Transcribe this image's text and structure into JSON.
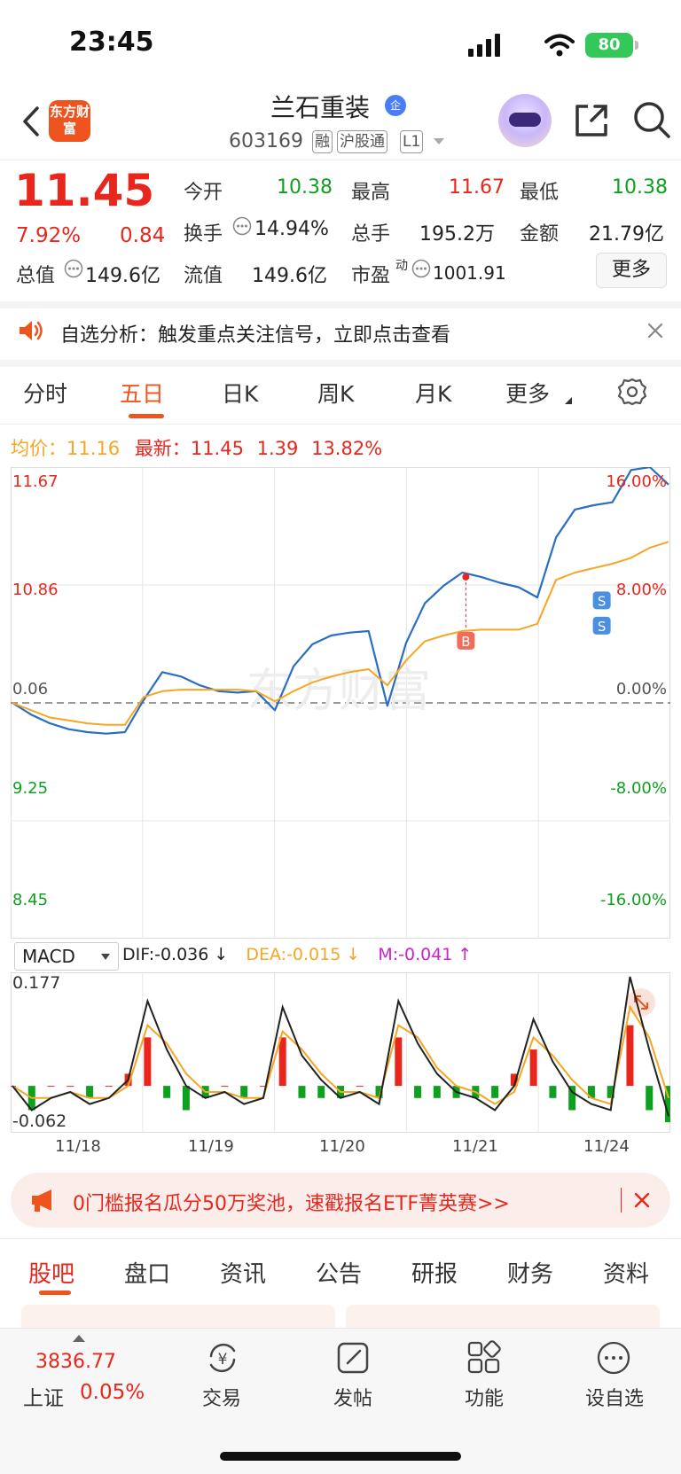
{
  "status_bar": {
    "time": "23:45",
    "battery": "80"
  },
  "header": {
    "logo_text": "东方财富",
    "stock_name": "兰石重装",
    "badge": "企",
    "stock_code": "603169",
    "tags": [
      "融",
      "沪股通",
      "L1"
    ]
  },
  "quote": {
    "price": "11.45",
    "change_pct": "7.92%",
    "change": "0.84",
    "open_label": "今开",
    "open": "10.38",
    "high_label": "最高",
    "high": "11.67",
    "low_label": "最低",
    "low": "10.38",
    "turnover_label": "换手",
    "turnover": "14.94%",
    "volume_label": "总手",
    "volume": "195.2万",
    "amount_label": "金额",
    "amount": "21.79亿",
    "mktcap_label": "总值",
    "mktcap": "149.6亿",
    "float_label": "流值",
    "float": "149.6亿",
    "pe_label": "市盈",
    "pe_sup": "动",
    "pe": "1001.91",
    "more_label": "更多"
  },
  "notice": {
    "text": "自选分析：触发重点关注信号，立即点击查看"
  },
  "chart_tabs": [
    "分时",
    "五日",
    "日K",
    "周K",
    "月K",
    "更多"
  ],
  "chart_tabs_active": "五日",
  "avg_line": {
    "avg_label": "均价：",
    "avg": "11.16",
    "latest_label": "最新：",
    "latest": "11.45",
    "change": "1.39",
    "pct": "13.82%"
  },
  "chart_data": {
    "type": "line",
    "x": [
      "11/18",
      "11/19",
      "11/20",
      "11/21",
      "11/24"
    ],
    "y_left_ticks": [
      "11.67",
      "10.86",
      "0.06",
      "9.25",
      "8.45"
    ],
    "y_right_ticks": [
      "16.00%",
      "8.00%",
      "0.00%",
      "-8.00%",
      "-16.00%"
    ],
    "ylim": [
      8.45,
      11.67
    ],
    "prev_close": 10.06,
    "series": [
      {
        "color": "#2a6fbf",
        "values": [
          10.06,
          9.98,
          9.92,
          9.88,
          9.86,
          9.85,
          9.86,
          10.08,
          10.27,
          10.24,
          10.18,
          10.14,
          10.13,
          10.14,
          10.01,
          10.31,
          10.46,
          10.52,
          10.54,
          10.55,
          10.04,
          10.47,
          10.74,
          10.86,
          10.95,
          10.92,
          10.88,
          10.85,
          10.78,
          11.19,
          11.38,
          11.41,
          11.43,
          11.65,
          11.67,
          11.55
        ]
      },
      {
        "color": "#f5a623",
        "values": [
          10.06,
          10.01,
          9.96,
          9.94,
          9.92,
          9.91,
          9.91,
          10.1,
          10.14,
          10.15,
          10.15,
          10.15,
          10.15,
          10.14,
          10.07,
          10.14,
          10.2,
          10.24,
          10.27,
          10.29,
          10.18,
          10.35,
          10.48,
          10.52,
          10.55,
          10.56,
          10.56,
          10.56,
          10.6,
          10.9,
          10.95,
          10.98,
          11.01,
          11.05,
          11.12,
          11.16
        ]
      }
    ],
    "markers": [
      {
        "label": "B",
        "x_index": 3,
        "price": 10.92,
        "color": "#e8261c"
      },
      {
        "label": "S",
        "x_index": 4,
        "price": 10.76,
        "color": "#2a6fbf"
      },
      {
        "label": "S",
        "x_index": 4,
        "price": 10.66,
        "color": "#2a6fbf"
      }
    ],
    "watermark": "东方财富"
  },
  "macd": {
    "selector": "MACD",
    "dif": "DIF:-0.036 ↓",
    "dea": "DEA:-0.015 ↓",
    "m": "M:-0.041 ↑",
    "top": "0.177",
    "bottom": "-0.062",
    "dif_series": [
      0,
      -0.04,
      -0.02,
      -0.01,
      -0.03,
      -0.02,
      0.01,
      0.14,
      0.06,
      0.0,
      -0.02,
      -0.01,
      -0.03,
      -0.02,
      0.13,
      0.05,
      0.01,
      -0.02,
      -0.01,
      -0.03,
      0.14,
      0.07,
      0.02,
      -0.01,
      -0.02,
      -0.04,
      0.0,
      0.11,
      0.04,
      -0.01,
      -0.03,
      -0.04,
      0.18,
      0.06,
      -0.05
    ],
    "dea_series": [
      0,
      -0.02,
      -0.02,
      -0.01,
      -0.02,
      -0.02,
      0.0,
      0.1,
      0.07,
      0.02,
      -0.01,
      -0.01,
      -0.02,
      -0.02,
      0.09,
      0.06,
      0.02,
      -0.01,
      -0.01,
      -0.02,
      0.1,
      0.08,
      0.03,
      0.0,
      -0.01,
      -0.03,
      -0.01,
      0.08,
      0.05,
      0.01,
      -0.02,
      -0.03,
      0.13,
      0.08,
      -0.02
    ]
  },
  "promo": {
    "text": "0门槛报名瓜分50万奖池，速戳报名ETF菁英赛>>"
  },
  "bottom_tabs": [
    "股吧",
    "盘口",
    "资讯",
    "公告",
    "研报",
    "财务",
    "资料"
  ],
  "footer": {
    "index_value": "3836.77",
    "index_name": "上证",
    "index_pct": "0.05%",
    "trade": "交易",
    "post": "发帖",
    "features": "功能",
    "watchlist": "设自选"
  }
}
